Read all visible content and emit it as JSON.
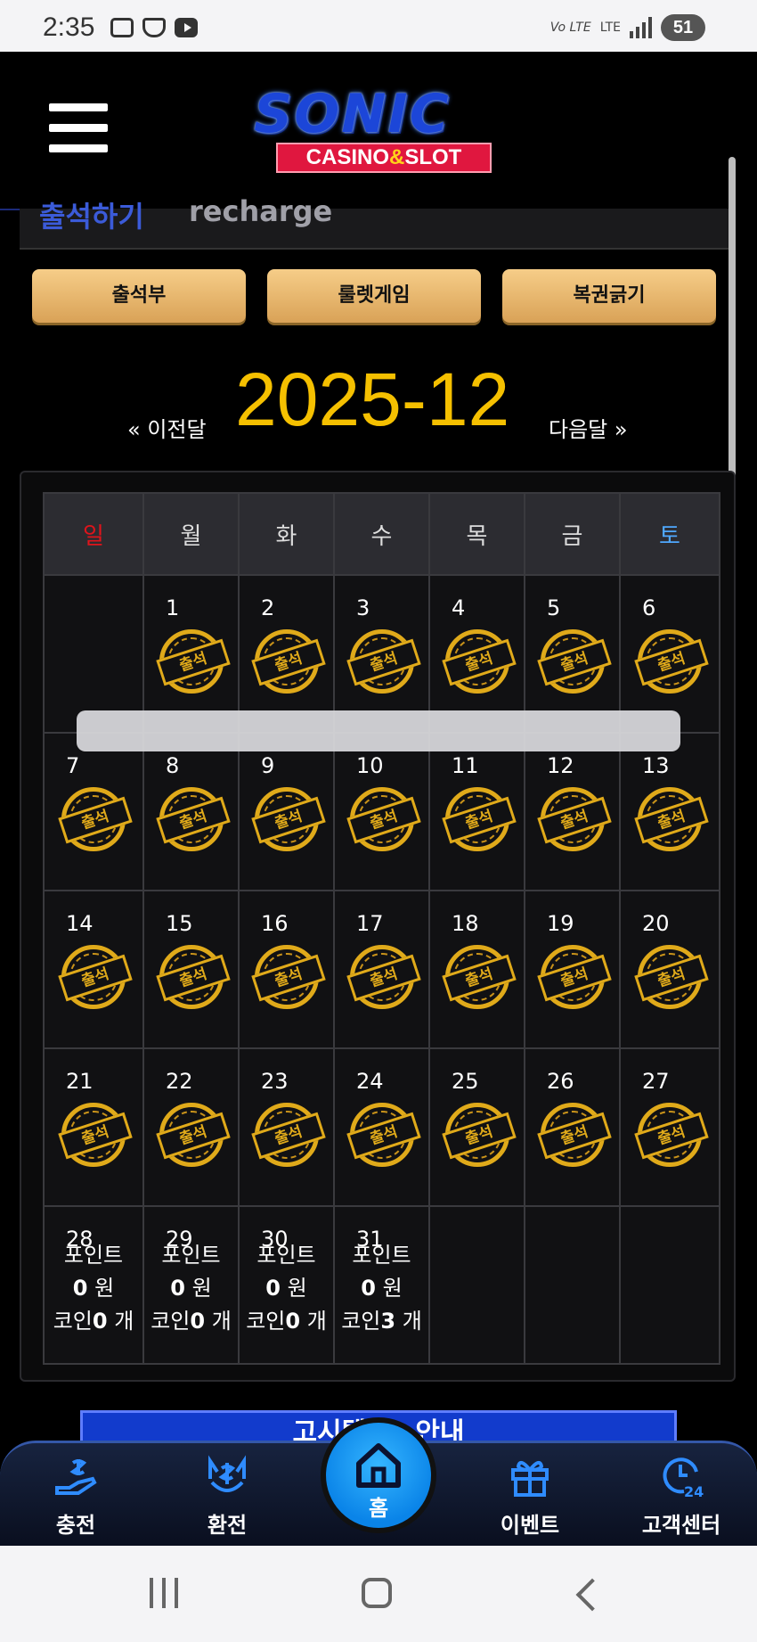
{
  "status_bar": {
    "time": "2:35",
    "volte": "Vo LTE",
    "lte": "LTE",
    "battery": "51"
  },
  "header": {
    "logo_main": "SONIC",
    "logo_sub_left": "CASINO",
    "logo_sub_amp": "&",
    "logo_sub_right": "SLOT"
  },
  "panel_fragment": {
    "text_ko": "출석하기",
    "text_en": "recharge"
  },
  "buttons": {
    "attendance": "출석부",
    "roulette": "룰렛게임",
    "lottery": "복권긁기"
  },
  "month_nav": {
    "prev": "« 이전달",
    "current": "2025-12",
    "next": "다음달 »"
  },
  "calendar": {
    "weekdays": [
      "일",
      "월",
      "화",
      "수",
      "목",
      "금",
      "토"
    ],
    "stamp_label": "출석",
    "days": [
      "1",
      "2",
      "3",
      "4",
      "5",
      "6",
      "7",
      "8",
      "9",
      "10",
      "11",
      "12",
      "13",
      "14",
      "15",
      "16",
      "17",
      "18",
      "19",
      "20",
      "21",
      "22",
      "23",
      "24",
      "25",
      "26",
      "27",
      "28",
      "29",
      "30",
      "31"
    ],
    "point_label": "포인트",
    "won_unit": "원",
    "coin_label": "코인",
    "coin_unit": "개",
    "point_days": [
      {
        "day": "28",
        "points": "0",
        "coins": "0"
      },
      {
        "day": "29",
        "points": "0",
        "coins": "0"
      },
      {
        "day": "30",
        "points": "0",
        "coins": "0"
      },
      {
        "day": "31",
        "points": "0",
        "coins": "3"
      }
    ]
  },
  "banner": {
    "text": "고시텔 ... 안내"
  },
  "bottom_nav": {
    "charge": "충전",
    "exchange": "환전",
    "home": "홈",
    "event": "이벤트",
    "support": "고객센터"
  }
}
